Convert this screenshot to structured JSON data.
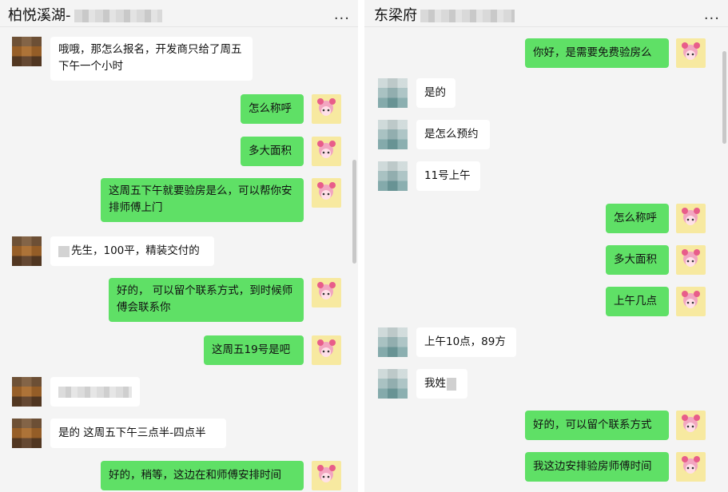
{
  "left_chat": {
    "title": "柏悦溪湖-",
    "more": "...",
    "messages": [
      {
        "side": "in",
        "avatar": "brown",
        "text": "哦哦，那怎么报名，开发商只给了周五下午一个小时"
      },
      {
        "side": "out",
        "text": "怎么称呼"
      },
      {
        "side": "out",
        "text": "多大面积"
      },
      {
        "side": "out",
        "text": "这周五下午就要验房是么，可以帮你安排师傅上门"
      },
      {
        "side": "in",
        "avatar": "brown",
        "text": "先生，100平，精装交付的"
      },
      {
        "side": "out",
        "text": "好的， 可以留个联系方式，到时候师傅会联系你"
      },
      {
        "side": "out",
        "text": "这周五19号是吧"
      },
      {
        "side": "in",
        "avatar": "brown",
        "text": ""
      },
      {
        "side": "in",
        "avatar": "brown",
        "text": "是的 这周五下午三点半-四点半"
      },
      {
        "side": "out",
        "text": "好的，稍等，这边在和师傅安排时间"
      }
    ]
  },
  "right_chat": {
    "title": "东梁府",
    "more": "...",
    "messages": [
      {
        "side": "out",
        "text": "你好，是需要免费验房么"
      },
      {
        "side": "in",
        "avatar": "teal",
        "text": "是的"
      },
      {
        "side": "in",
        "avatar": "teal",
        "text": "是怎么预约"
      },
      {
        "side": "in",
        "avatar": "teal",
        "text": "11号上午"
      },
      {
        "side": "out",
        "text": "怎么称呼"
      },
      {
        "side": "out",
        "text": "多大面积"
      },
      {
        "side": "out",
        "text": "上午几点"
      },
      {
        "side": "in",
        "avatar": "teal",
        "text": "上午10点，89方"
      },
      {
        "side": "in",
        "avatar": "teal",
        "text": "我姓"
      },
      {
        "side": "out",
        "text": "好的，可以留个联系方式"
      },
      {
        "side": "out",
        "text": "我这边安排验房师傅时间"
      }
    ]
  },
  "colors": {
    "outgoing_bubble": "#5fe066",
    "incoming_bubble": "#ffffff",
    "chat_background": "#f4f4f4"
  }
}
